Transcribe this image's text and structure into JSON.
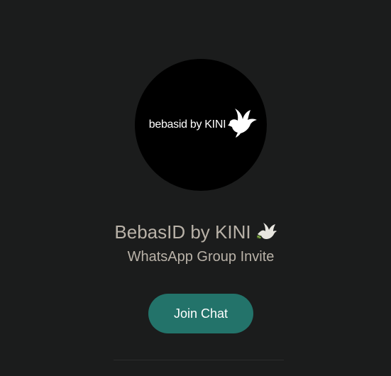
{
  "group": {
    "avatar_text": "bebasid by KINI",
    "avatar_icon": "dove-icon",
    "name": "BebasID by KINI",
    "name_emoji_icon": "dove-with-olive-branch-icon",
    "subtitle": "WhatsApp Group Invite"
  },
  "actions": {
    "join_label": "Join Chat"
  },
  "colors": {
    "background": "#1b1c1c",
    "text": "#b9b2a8",
    "button": "#23736a",
    "button_text": "#ffffff",
    "avatar_bg": "#000000"
  }
}
